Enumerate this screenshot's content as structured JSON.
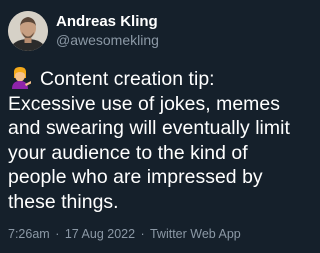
{
  "author": {
    "display_name": "Andreas Kling",
    "handle": "@awesomekling"
  },
  "tweet": {
    "emoji": "person-tipping-hand-emoji",
    "text": "Content creation tip: Excessive use of jokes, memes and swearing will eventually limit your audience to the kind of people who are impressed by these things."
  },
  "meta": {
    "time": "7:26am",
    "separator": "·",
    "date": "17 Aug 2022",
    "source": "Twitter Web App"
  },
  "colors": {
    "background": "#15202b",
    "primary_text": "#ffffff",
    "secondary_text": "#8b98a5"
  }
}
